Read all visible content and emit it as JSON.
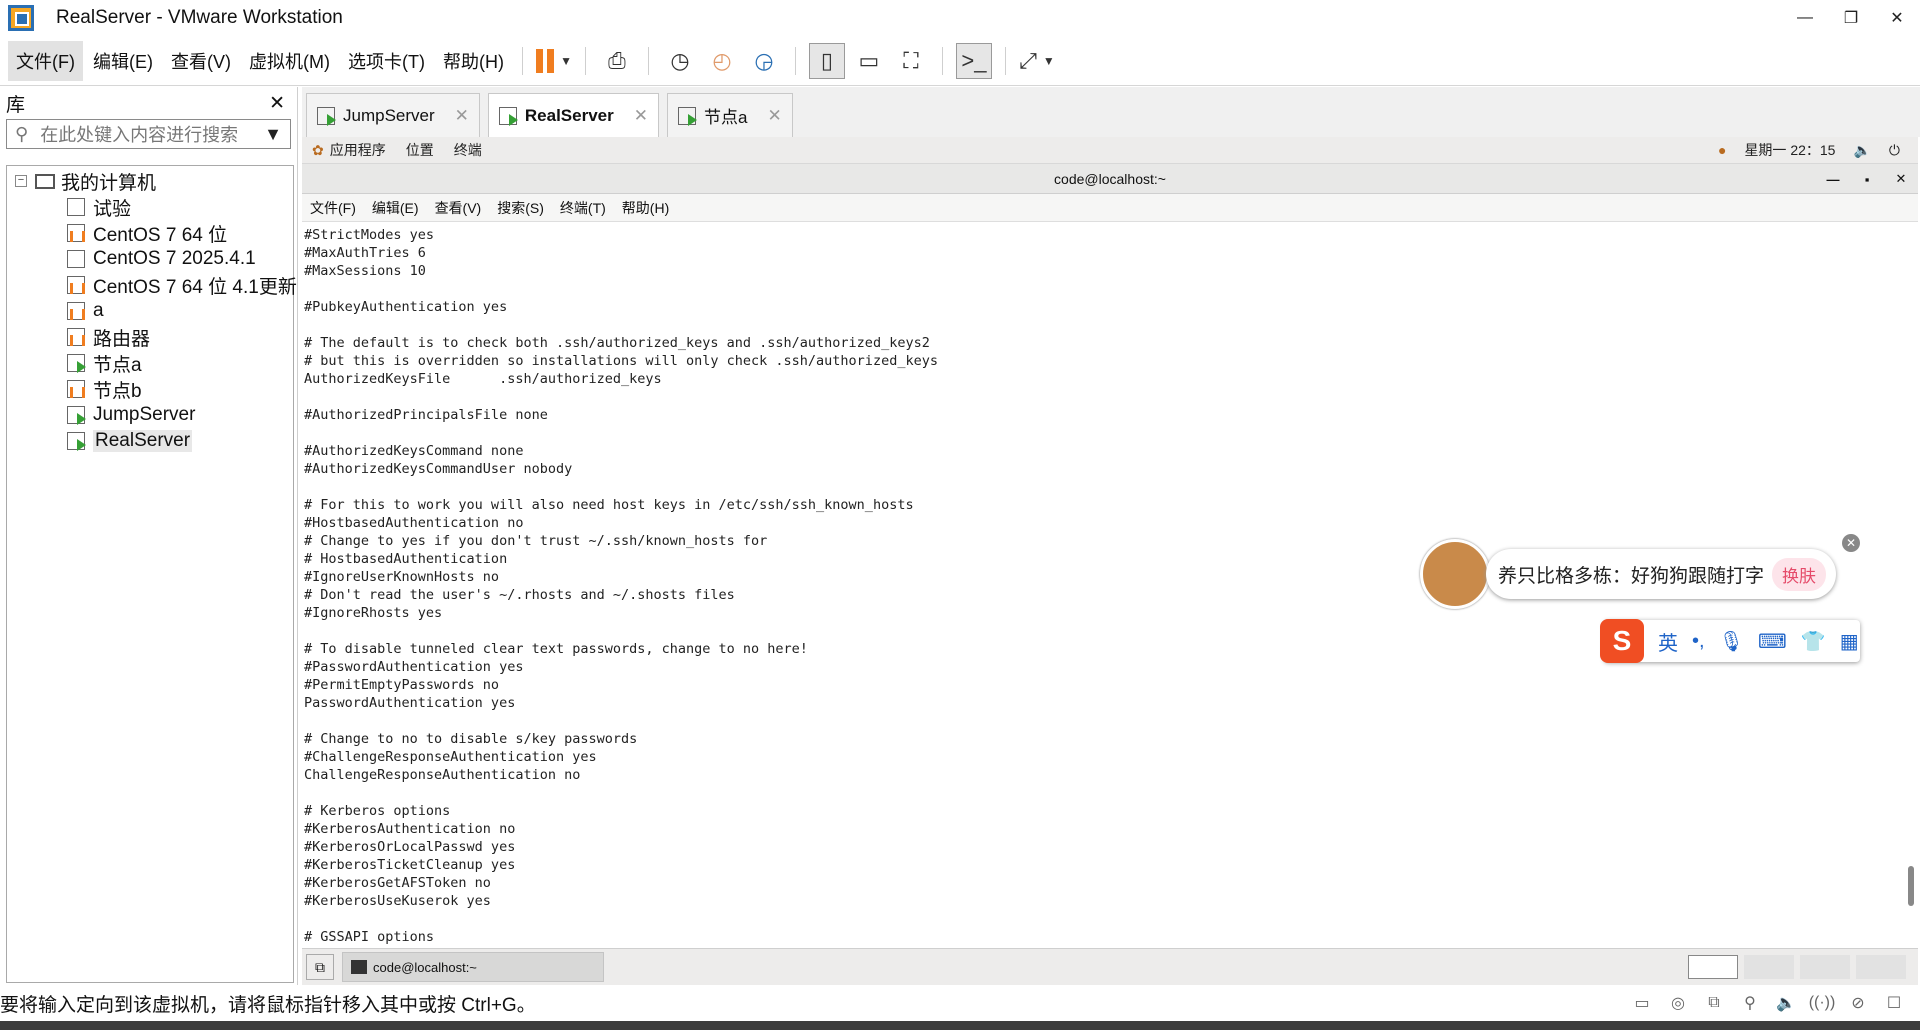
{
  "window": {
    "title": "RealServer - VMware Workstation"
  },
  "menubar": {
    "items": [
      "文件(F)",
      "编辑(E)",
      "查看(V)",
      "虚拟机(M)",
      "选项卡(T)",
      "帮助(H)"
    ]
  },
  "library": {
    "title": "库",
    "search_placeholder": "在此处键入内容进行搜索",
    "root": "我的计算机",
    "items": [
      {
        "label": "试验",
        "state": "off"
      },
      {
        "label": "CentOS 7 64 位",
        "state": "paused"
      },
      {
        "label": "CentOS 7 2025.4.1",
        "state": "off"
      },
      {
        "label": "CentOS 7 64 位 4.1更新",
        "state": "paused"
      },
      {
        "label": "a",
        "state": "paused"
      },
      {
        "label": "路由器",
        "state": "paused"
      },
      {
        "label": "节点a",
        "state": "on"
      },
      {
        "label": "节点b",
        "state": "paused"
      },
      {
        "label": "JumpServer",
        "state": "on"
      },
      {
        "label": "RealServer",
        "state": "on"
      }
    ]
  },
  "tabs": [
    {
      "label": "JumpServer",
      "active": false
    },
    {
      "label": "RealServer",
      "active": true
    },
    {
      "label": "节点a",
      "active": false
    }
  ],
  "guest": {
    "gnome_menu": [
      "应用程序",
      "位置",
      "终端"
    ],
    "clock": "星期一 22：15",
    "terminal_title": "code@localhost:~",
    "terminal_menu": [
      "文件(F)",
      "编辑(E)",
      "查看(V)",
      "搜索(S)",
      "终端(T)",
      "帮助(H)"
    ],
    "terminal_lines": [
      "#StrictModes yes",
      "#MaxAuthTries 6",
      "#MaxSessions 10",
      "",
      "#PubkeyAuthentication yes",
      "",
      "# The default is to check both .ssh/authorized_keys and .ssh/authorized_keys2",
      "# but this is overridden so installations will only check .ssh/authorized_keys",
      "AuthorizedKeysFile      .ssh/authorized_keys",
      "",
      "#AuthorizedPrincipalsFile none",
      "",
      "#AuthorizedKeysCommand none",
      "#AuthorizedKeysCommandUser nobody",
      "",
      "# For this to work you will also need host keys in /etc/ssh/ssh_known_hosts",
      "#HostbasedAuthentication no",
      "# Change to yes if you don't trust ~/.ssh/known_hosts for",
      "# HostbasedAuthentication",
      "#IgnoreUserKnownHosts no",
      "# Don't read the user's ~/.rhosts and ~/.shosts files",
      "#IgnoreRhosts yes",
      "",
      "# To disable tunneled clear text passwords, change to no here!",
      "#PasswordAuthentication yes",
      "#PermitEmptyPasswords no",
      "PasswordAuthentication yes",
      "",
      "# Change to no to disable s/key passwords",
      "#ChallengeResponseAuthentication yes",
      "ChallengeResponseAuthentication no",
      "",
      "# Kerberos options",
      "#KerberosAuthentication no",
      "#KerberosOrLocalPasswd yes",
      "#KerberosTicketCleanup yes",
      "#KerberosGetAFSToken no",
      "#KerberosUseKuserok yes",
      "",
      "# GSSAPI options"
    ],
    "taskbar_item": "code@localhost:~"
  },
  "ime": {
    "tip": "养只比格多栋：好狗狗跟随打字",
    "swap": "换肤",
    "bubble_tag": "",
    "mode": "英",
    "logo": "S"
  },
  "statusbar": {
    "message": "要将输入定向到该虚拟机，请将鼠标指针移入其中或按 Ctrl+G。"
  },
  "colors": {
    "accent_orange": "#f07d1f",
    "running_green": "#35a035",
    "ime_red": "#f04e23"
  }
}
